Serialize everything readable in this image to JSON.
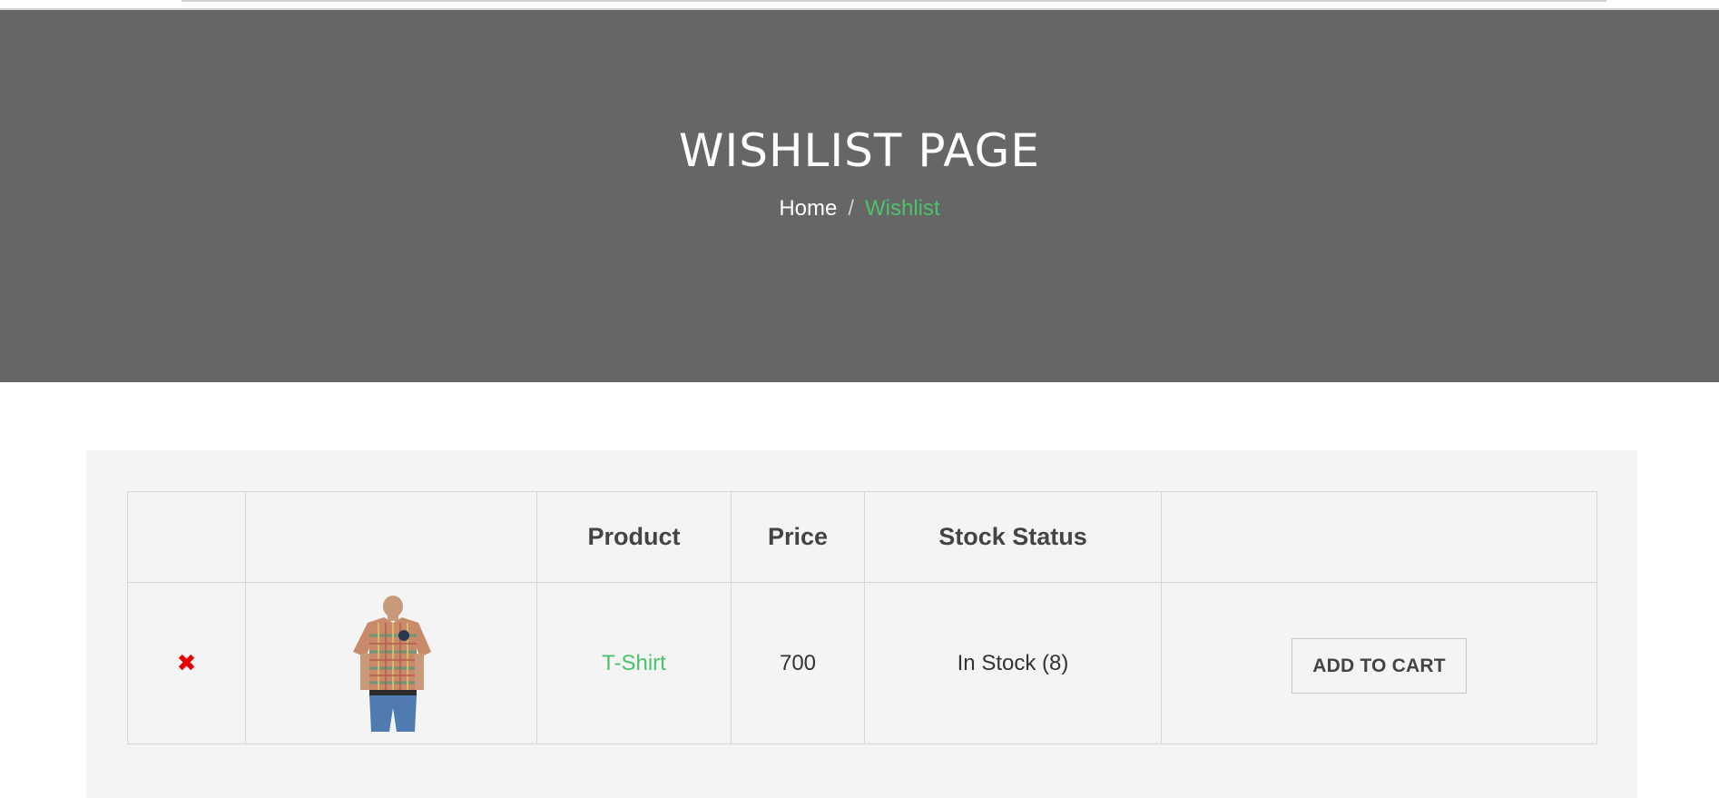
{
  "hero": {
    "title": "WISHLIST PAGE",
    "breadcrumb": {
      "home": "Home",
      "separator": "/",
      "current": "Wishlist"
    }
  },
  "table": {
    "headers": [
      "",
      "",
      "Product",
      "Price",
      "Stock Status",
      ""
    ],
    "rows": [
      {
        "remove_icon": "close-icon",
        "image": "tshirt-product-image",
        "product": "T-Shirt",
        "price": "700",
        "stock_status": "In Stock (8)",
        "action_label": "ADD TO CART"
      }
    ]
  },
  "colors": {
    "hero_bg": "#666666",
    "accent": "#4cc36a",
    "remove": "#e60000",
    "panel_bg": "#f4f4f4"
  }
}
